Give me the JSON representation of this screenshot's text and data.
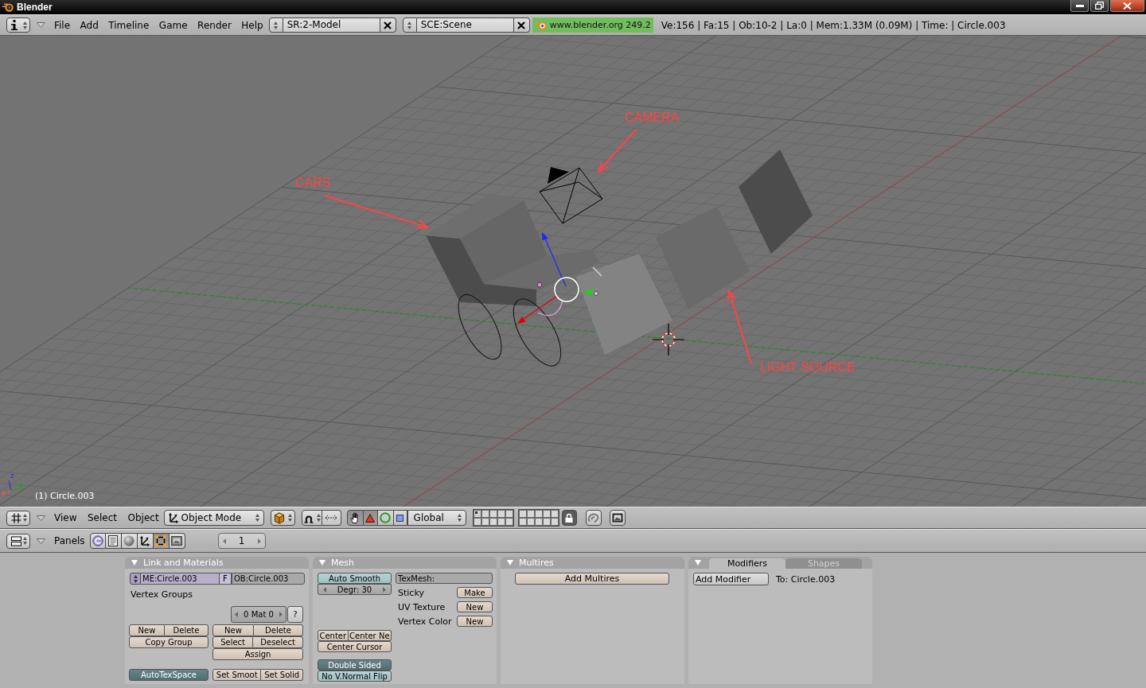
{
  "window": {
    "title": "Blender"
  },
  "info_header": {
    "menus": [
      "File",
      "Add",
      "Timeline",
      "Game",
      "Render",
      "Help"
    ],
    "screen": "SR:2-Model",
    "scene": "SCE:Scene",
    "version": "www.blender.org 249.2",
    "stats": "Ve:156 | Fa:15 | Ob:10-2 | La:0 | Mem:1.33M (0.09M) | Time: | Circle.003"
  },
  "viewport": {
    "annotations": [
      "CARS",
      "CAMERA",
      "LIGHT SOURCE"
    ],
    "axis_labels": [
      {
        "text": "z",
        "color": "#4040c8"
      },
      {
        "text": "y",
        "color": "#20a020"
      },
      {
        "text": "x",
        "color": "#ff5050"
      }
    ],
    "object_label": "(1) Circle.003"
  },
  "view_header": {
    "menus": [
      "View",
      "Select",
      "Object"
    ],
    "mode": "Object Mode",
    "manipulators": [
      {
        "kind": "hand",
        "selected": true
      },
      {
        "kind": "translate",
        "selected": true
      },
      {
        "kind": "rotate",
        "selected": false
      },
      {
        "kind": "scale",
        "selected": false
      }
    ],
    "orientation": "Global",
    "layers": [
      {
        "used": true
      },
      {
        "used": false
      },
      {
        "used": false
      },
      {
        "used": false
      },
      {
        "used": false
      },
      {
        "used": false
      },
      {
        "used": false
      },
      {
        "used": false
      },
      {
        "used": false
      },
      {
        "used": false
      },
      {
        "used": false
      },
      {
        "used": false
      },
      {
        "used": false
      },
      {
        "used": false
      },
      {
        "used": false
      },
      {
        "used": false
      },
      {
        "used": false
      },
      {
        "used": false
      },
      {
        "used": false
      },
      {
        "used": false
      }
    ],
    "lock": {
      "on": true
    }
  },
  "buttons_header": {
    "label": "Panels",
    "contexts": [
      {
        "kind": "logic",
        "selected": false
      },
      {
        "kind": "script",
        "selected": false
      },
      {
        "kind": "shading",
        "selected": false
      },
      {
        "kind": "object",
        "selected": false
      },
      {
        "kind": "editing",
        "selected": true
      },
      {
        "kind": "scene",
        "selected": false
      }
    ],
    "frame": "1"
  },
  "panels": [
    {
      "kind": "link_materials",
      "title": "Link and Materials",
      "mesh": "ME:Circle.003",
      "fake_user": "F",
      "object": "OB:Circle.003",
      "vertex_groups": "Vertex Groups",
      "material": "0 Mat 0",
      "help": "?",
      "group_buttons": [
        "New",
        "Delete",
        "Copy Group"
      ],
      "material_buttons": [
        "New",
        "Delete",
        "Select",
        "Deselect",
        "Assign"
      ],
      "auto_tex_space": {
        "label": "AutoTexSpace",
        "on": true
      },
      "shade_buttons": [
        "Set Smoot",
        "Set Solid"
      ]
    },
    {
      "kind": "mesh",
      "title": "Mesh",
      "auto_smooth": {
        "label": "Auto Smooth",
        "on": false
      },
      "degree": "Degr: 30",
      "tex_mesh": "TexMesh:",
      "rows": [
        {
          "label": "Sticky",
          "button": "Make"
        },
        {
          "label": "UV Texture",
          "button": "New"
        },
        {
          "label": "Vertex Color",
          "button": "New"
        }
      ],
      "center_buttons": [
        "Center",
        "Center Ne",
        "Center Cursor"
      ],
      "toggles": [
        {
          "label": "Double Sided",
          "on": true
        },
        {
          "label": "No V.Normal Flip",
          "on": false
        }
      ]
    },
    {
      "kind": "multires",
      "title": "Multires",
      "button": "Add Multires"
    },
    {
      "kind": "modifiers",
      "tabs": [
        {
          "label": "Modifiers",
          "selected": true
        },
        {
          "label": "Shapes",
          "selected": false
        }
      ],
      "button": "Add Modifier",
      "target": "To: Circle.003"
    }
  ]
}
